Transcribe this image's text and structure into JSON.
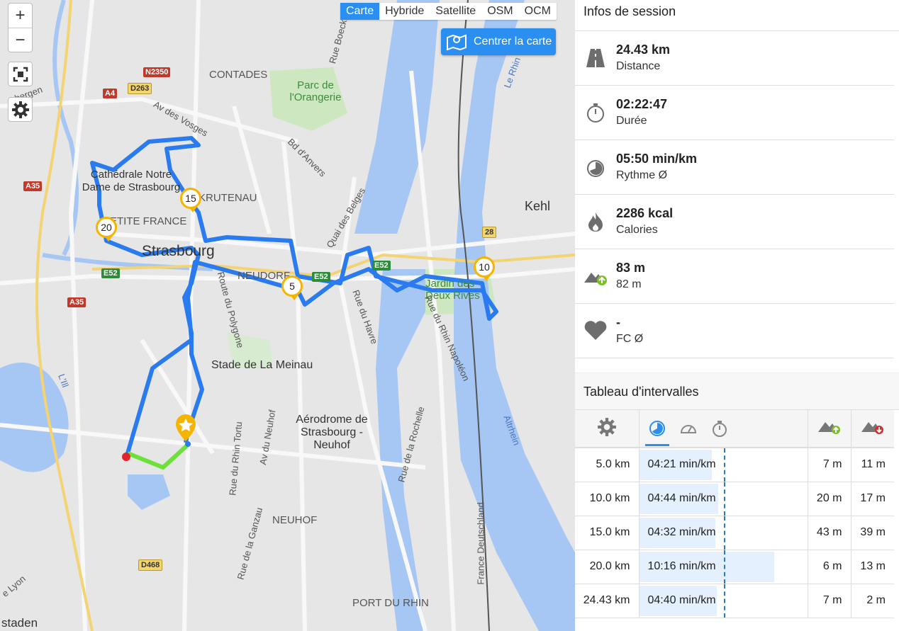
{
  "map": {
    "layers": [
      "Carte",
      "Hybride",
      "Satellite",
      "OSM",
      "OCM"
    ],
    "active_layer": "Carte",
    "zoom_in": "+",
    "zoom_out": "−",
    "center_button": "Centrer la carte",
    "places": {
      "contades": "CONTADES",
      "parc": "Parc de l'Orangerie",
      "cathedrale": "Cathédrale Notre Dame de Strasbourg",
      "petite_france": "PETITE FRANCE",
      "strasbourg": "Strasbourg",
      "neudorf": "NEUDORF",
      "kehl": "Kehl",
      "jardin": "Jardin des Deux Rives",
      "stade": "Stade de La Meinau",
      "aerodrome": "Aérodrome de Strasbourg - Neuhof",
      "neuhof": "NEUHOF",
      "port_du_rhin": "PORT DU RHIN",
      "krutenau": "KRUTENAU",
      "staden": "staden",
      "av_vosges": "Av des Vosges",
      "bd_anvers": "Bd d'Anvers",
      "quai_belges": "Quai des Belges",
      "rue_havre": "Rue du Havre",
      "route_polygone": "Route du Polygone",
      "rue_rhin_napoleon": "Rue du Rhin Napoléon",
      "rue_rochelle": "Rue de la Rochelle",
      "av_neuhof": "Av du Neuhof",
      "rue_rhin_tortu": "Rue du Rhin Tortu",
      "rue_ganzau": "Rue de la Ganzau",
      "rue_boecklin": "Rue Boecklin",
      "le_rhin": "Le Rhin",
      "altrhein": "Altrhein",
      "lill": "L'Ill",
      "france_deutschland": "France Deutschland",
      "route_lyon": "e Lyon",
      "bergen": "bergen"
    },
    "shields": {
      "n2350": "N2350",
      "a4": "A4",
      "d263": "D263",
      "a35a": "A35",
      "a35b": "A35",
      "e52a": "E52",
      "e52b": "E52",
      "e52c": "E52",
      "r28": "28",
      "d468": "D468"
    },
    "km_markers": [
      "5",
      "10",
      "15",
      "20"
    ],
    "colors": {
      "route": "#2a7bef",
      "route_end": "#6ee03a",
      "marker": "#f5b400",
      "start": "#e0242a"
    }
  },
  "session": {
    "title": "Infos de session",
    "stats": [
      {
        "icon": "road-icon",
        "value": "24.43 km",
        "label": "Distance"
      },
      {
        "icon": "stopwatch-icon",
        "value": "02:22:47",
        "label": "Durée"
      },
      {
        "icon": "pace-icon",
        "value": "05:50 min/km",
        "label": "Rythme Ø"
      },
      {
        "icon": "flame-icon",
        "value": "2286 kcal",
        "label": "Calories"
      },
      {
        "icon": "ascent-icon",
        "value": "83 m",
        "label": "82 m"
      },
      {
        "icon": "heart-icon",
        "value": "-",
        "label": "FC Ø"
      }
    ]
  },
  "intervals": {
    "title": "Tableau d'intervalles",
    "rows": [
      {
        "dist": "5.0 km",
        "pace": "04:21 min/km",
        "pace_level": 0.43,
        "up": "7 m",
        "down": "11 m"
      },
      {
        "dist": "10.0 km",
        "pace": "04:44 min/km",
        "pace_level": 0.47,
        "up": "20 m",
        "down": "17 m"
      },
      {
        "dist": "15.0 km",
        "pace": "04:32 min/km",
        "pace_level": 0.45,
        "up": "43 m",
        "down": "39 m"
      },
      {
        "dist": "20.0 km",
        "pace": "10:16 min/km",
        "pace_level": 0.8,
        "up": "6 m",
        "down": "13 m"
      },
      {
        "dist": "24.43 km",
        "pace": "04:40 min/km",
        "pace_level": 0.46,
        "up": "7 m",
        "down": "2 m"
      }
    ]
  }
}
